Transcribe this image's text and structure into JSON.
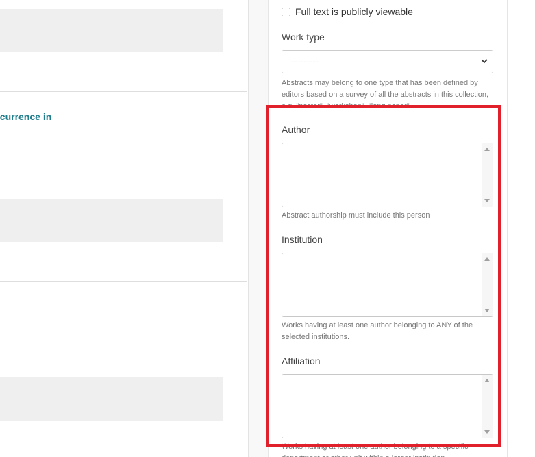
{
  "results": {
    "visible_title_fragment": "ccurrence in"
  },
  "filters": {
    "fulltext_checkbox_label": "Full text is publicly viewable",
    "work_type": {
      "label": "Work type",
      "selected": "---------",
      "help": "Abstracts may belong to one type that has been defined by editors based on a survey of all the abstracts in this collection, e.g. \"poster\", \"workshop\", \"long paper\"."
    },
    "author": {
      "label": "Author",
      "help": "Abstract authorship must include this person"
    },
    "institution": {
      "label": "Institution",
      "help": "Works having at least one author belonging to ANY of the selected institutions."
    },
    "affiliation": {
      "label": "Affiliation",
      "help": "Works having at least one author belonging to a specific department or other unit within a larger institution."
    }
  },
  "colors": {
    "highlight": "#e0202a",
    "link": "#1e7d8c"
  }
}
